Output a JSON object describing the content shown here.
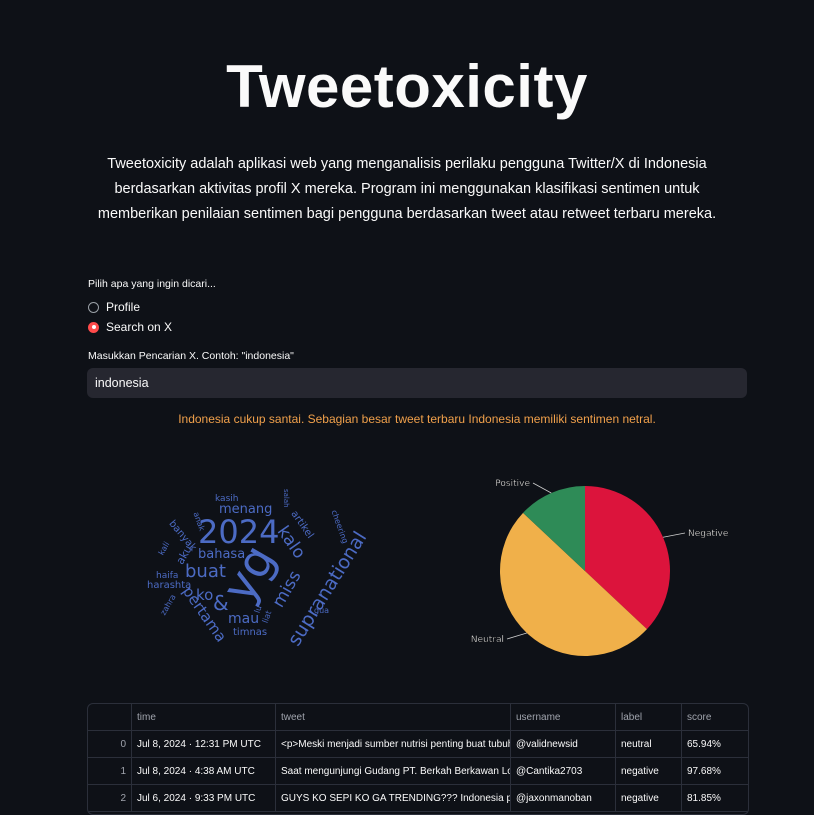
{
  "app": {
    "title": "Tweetoxicity",
    "description": "Tweetoxicity adalah aplikasi web yang menganalisis perilaku pengguna Twitter/X di Indonesia berdasarkan aktivitas profil X mereka. Program ini menggunakan klasifikasi sentimen untuk memberikan penilaian sentimen bagi pengguna berdasarkan tweet atau retweet terbaru mereka."
  },
  "search_mode": {
    "label": "Pilih apa yang ingin dicari...",
    "options": [
      "Profile",
      "Search on X"
    ],
    "selected": "Search on X"
  },
  "search": {
    "label": "Masukkan Pencarian X. Contoh: \"indonesia\"",
    "value": "indonesia"
  },
  "verdict": {
    "text": "Indonesia cukup santai. Sebagian besar tweet terbaru Indonesia memiliki sentimen netral.",
    "color": "#f0a04b"
  },
  "wordcloud": {
    "color": "#4c6bc4",
    "words": [
      "yg",
      "2024",
      "supranational",
      "kalo",
      "buat",
      "miss",
      "pertama",
      "ko",
      "&",
      "mau",
      "menang",
      "bahasa",
      "artikel",
      "aku",
      "banyak",
      "kasih",
      "timnas",
      "harashta",
      "haifa",
      "zahra",
      "kali",
      "anak",
      "salah",
      "cheering",
      "gua",
      "lu",
      "liat"
    ]
  },
  "chart_data": {
    "type": "pie",
    "categories": [
      "Negative",
      "Neutral",
      "Positive"
    ],
    "values": [
      37,
      50,
      13
    ],
    "colors": [
      "#dc143c",
      "#f0b04a",
      "#2e8b57"
    ],
    "labels": [
      "Negative",
      "Neutral",
      "Positive"
    ]
  },
  "table": {
    "columns": [
      "",
      "time",
      "tweet",
      "username",
      "label",
      "score"
    ],
    "rows": [
      [
        "0",
        "Jul 8, 2024 · 12:31 PM UTC",
        "<p>Meski menjadi sumber nutrisi penting buat tubuh",
        "@validnewsid",
        "neutral",
        "65.94%"
      ],
      [
        "1",
        "Jul 8, 2024 · 4:38 AM UTC",
        "Saat mengunjungi Gudang PT. Berkah Berkawan Log",
        "@Cantika2703",
        "negative",
        "97.68%"
      ],
      [
        "2",
        "Jul 6, 2024 · 9:33 PM UTC",
        "GUYS KO SEPI KO GA TRENDING??? Indonesia pertan",
        "@jaxonmanoban",
        "negative",
        "81.85%"
      ]
    ]
  }
}
